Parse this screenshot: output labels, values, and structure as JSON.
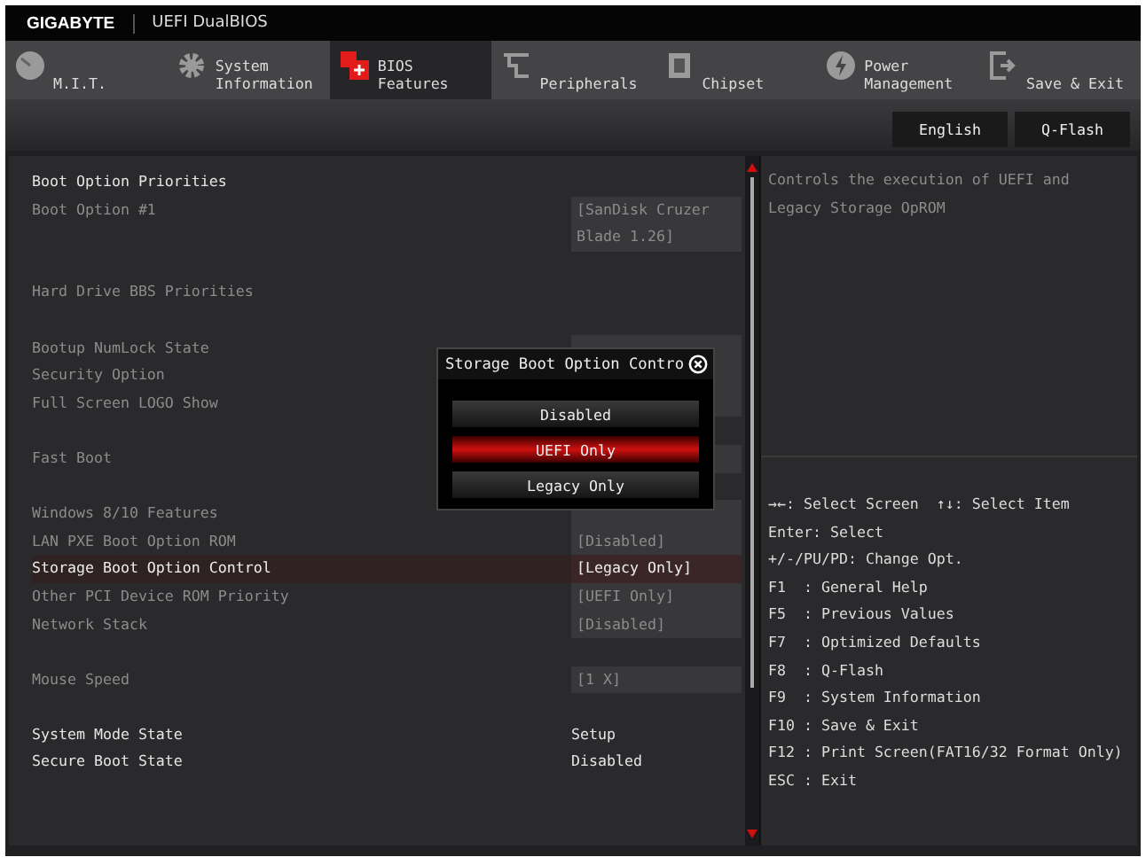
{
  "header": {
    "brand": "GIGABYTE",
    "title": "UEFI DualBIOS"
  },
  "tabs": [
    {
      "label": "M.I.T.",
      "selected": false
    },
    {
      "label": "System Information",
      "selected": false
    },
    {
      "label": "BIOS Features",
      "selected": true
    },
    {
      "label": "Peripherals",
      "selected": false
    },
    {
      "label": "Chipset",
      "selected": false
    },
    {
      "label": "Power Management",
      "selected": false
    },
    {
      "label": "Save & Exit",
      "selected": false
    }
  ],
  "toolbar": [
    "English",
    "Q-Flash"
  ],
  "settings": [
    {
      "kind": "header",
      "label": "Boot Option Priorities"
    },
    {
      "kind": "option",
      "label": "Boot Option #1",
      "value": "[SanDisk Cruzer Blade 1.26]",
      "selected": false
    },
    {
      "kind": "spacer"
    },
    {
      "kind": "submenu",
      "label": "Hard Drive BBS Priorities"
    },
    {
      "kind": "spacer"
    },
    {
      "kind": "option",
      "label": "Bootup NumLock State",
      "selected": false
    },
    {
      "kind": "option",
      "label": "Security Option",
      "selected": false
    },
    {
      "kind": "option",
      "label": "Full Screen LOGO Show",
      "selected": false
    },
    {
      "kind": "spacer"
    },
    {
      "kind": "option",
      "label": "Fast Boot",
      "selected": false
    },
    {
      "kind": "spacer"
    },
    {
      "kind": "option",
      "label": "Windows 8/10 Features",
      "selected": false
    },
    {
      "kind": "option",
      "label": "LAN PXE Boot Option ROM",
      "value": "[Disabled]",
      "selected": false
    },
    {
      "kind": "option",
      "label": "Storage Boot Option Control",
      "value": "[Legacy Only]",
      "selected": true
    },
    {
      "kind": "option",
      "label": "Other PCI Device ROM Priority",
      "value": "[UEFI Only]",
      "selected": false
    },
    {
      "kind": "option",
      "label": "Network Stack",
      "value": "[Disabled]",
      "selected": false
    },
    {
      "kind": "spacer"
    },
    {
      "kind": "option",
      "label": "Mouse Speed",
      "value": "[1 X]",
      "selected": false
    },
    {
      "kind": "spacer"
    },
    {
      "kind": "info",
      "label": "System Mode State",
      "value": "Setup"
    },
    {
      "kind": "info",
      "label": "Secure Boot State",
      "value": "Disabled"
    }
  ],
  "help": "Controls the execution of UEFI and Legacy Storage OpROM",
  "keys": [
    "→←: Select Screen  ↑↓: Select Item",
    "Enter: Select",
    "+/-/PU/PD: Change Opt.",
    "F1  : General Help",
    "F5  : Previous Values",
    "F7  : Optimized Defaults",
    "F8  : Q-Flash",
    "F9  : System Information",
    "F10 : Save & Exit",
    "F12 : Print Screen(FAT16/32 Format Only)",
    "ESC : Exit"
  ],
  "popup": {
    "title": "Storage Boot Option Contro",
    "options": [
      {
        "label": "Disabled",
        "selected": false
      },
      {
        "label": "UEFI Only",
        "selected": true
      },
      {
        "label": "Legacy Only",
        "selected": false
      }
    ]
  }
}
